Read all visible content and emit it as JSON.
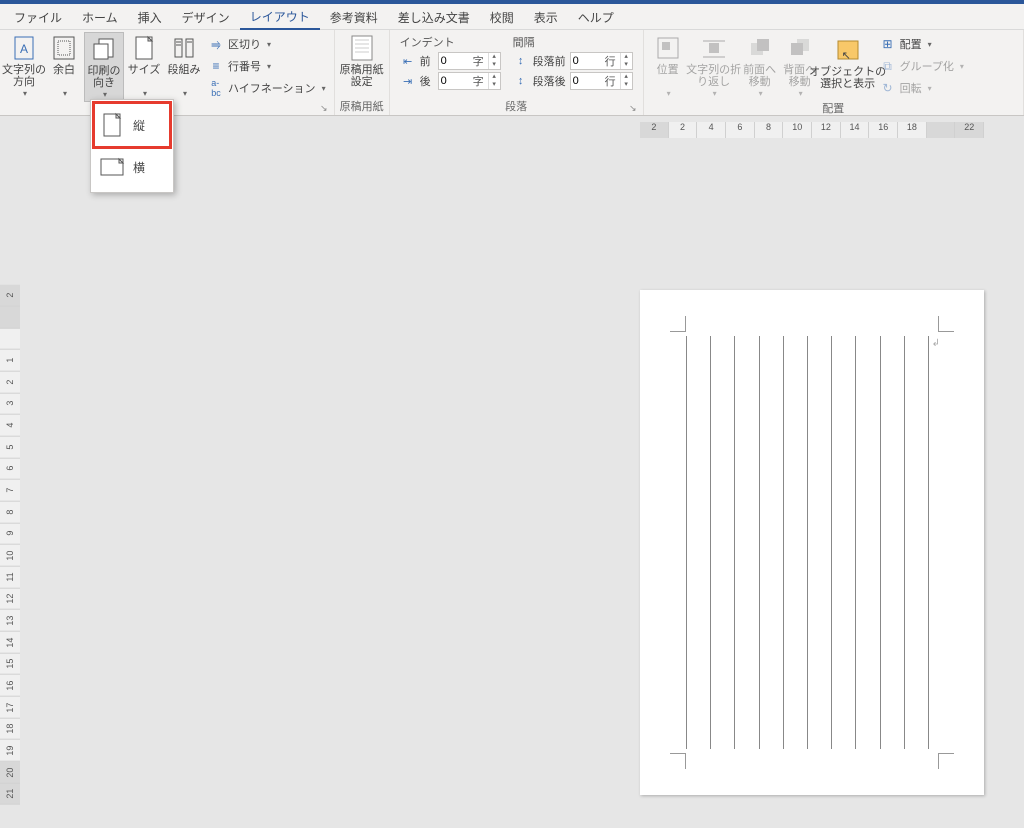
{
  "tabs": {
    "file": "ファイル",
    "home": "ホーム",
    "insert": "挿入",
    "design": "デザイン",
    "layout": "レイアウト",
    "references": "参考資料",
    "mailings": "差し込み文書",
    "review": "校閲",
    "view": "表示",
    "help": "ヘルプ"
  },
  "pagesetup": {
    "text_direction": "文字列の\n方向",
    "margins": "余白",
    "orientation": "印刷の\n向き",
    "size": "サイズ",
    "columns": "段組み",
    "breaks": "区切り",
    "line_numbers": "行番号",
    "hyphenation": "ハイフネーション"
  },
  "manuscript": {
    "button": "原稿用紙\n設定",
    "label": "原稿用紙"
  },
  "paragraph": {
    "indent_title": "インデント",
    "left_label": "前",
    "right_label": "後",
    "left_value": "0",
    "right_value": "0",
    "indent_unit": "字",
    "spacing_title": "間隔",
    "before_label": "段落前",
    "after_label": "段落後",
    "before_value": "0",
    "after_value": "0",
    "spacing_unit": "行",
    "label": "段落"
  },
  "arrange": {
    "position": "位置",
    "wrap": "文字列の折\nり返し",
    "forward": "前面へ\n移動",
    "backward": "背面へ\n移動",
    "selection": "オブジェクトの\n選択と表示",
    "align": "配置",
    "group": "グループ化",
    "rotate": "回転",
    "label": "配置"
  },
  "orientation_menu": {
    "portrait": "縦",
    "landscape": "横"
  },
  "hruler_labels": [
    "2",
    "2",
    "4",
    "6",
    "8",
    "10",
    "12",
    "14",
    "16",
    "18",
    "",
    "22"
  ],
  "vruler_labels": [
    "21",
    "20",
    "19",
    "18",
    "17",
    "16",
    "15",
    "14",
    "13",
    "12",
    "11",
    "10",
    "9",
    "8",
    "7",
    "6",
    "5",
    "4",
    "3",
    "2",
    "1",
    "",
    "",
    "2"
  ]
}
